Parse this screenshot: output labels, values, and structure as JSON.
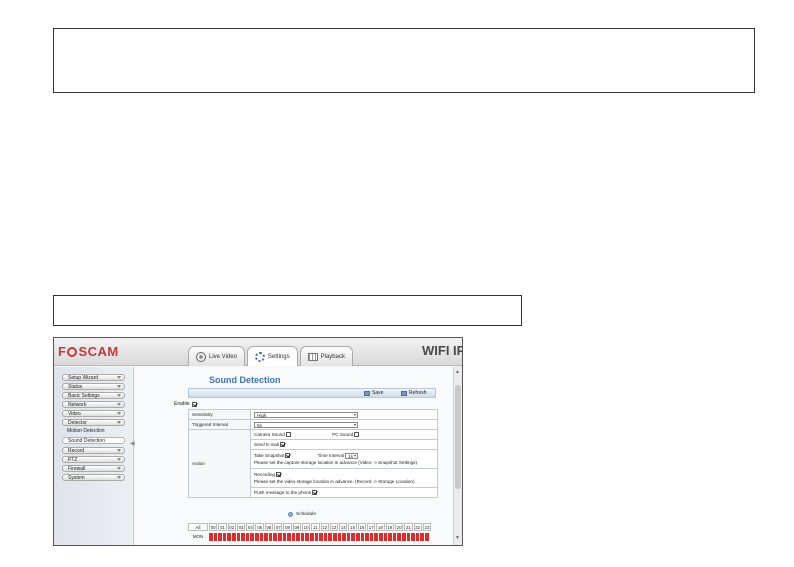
{
  "app": {
    "logo": "F   SCAM",
    "brand": "WIFI IP C"
  },
  "tabs": [
    {
      "label": "Live Video",
      "icon": "camera-icon"
    },
    {
      "label": "Settings",
      "icon": "gear-icon"
    },
    {
      "label": "Playback",
      "icon": "film-icon"
    }
  ],
  "sidebar": {
    "items": [
      {
        "label": "Setup Wizard"
      },
      {
        "label": "Status"
      },
      {
        "label": "Basic Settings"
      },
      {
        "label": "Network"
      },
      {
        "label": "Video"
      },
      {
        "label": "Detector"
      }
    ],
    "subitems": [
      {
        "label": "Motion Detection"
      },
      {
        "label": "Sound Detection"
      }
    ],
    "items_after": [
      {
        "label": "Record"
      },
      {
        "label": "PTZ"
      },
      {
        "label": "Firewall"
      },
      {
        "label": "System"
      }
    ]
  },
  "page": {
    "title": "Sound Detection",
    "save_label": "Save",
    "refresh_label": "Refresh",
    "enable_label": "Enable"
  },
  "form": {
    "sensitivity_label": "Sensitivity",
    "sensitivity_value": "High",
    "interval_label": "Triggered Interval",
    "interval_value": "5s",
    "action_label": "Action",
    "camera_sound": "Camera Sound",
    "pc_sound": "PC Sound",
    "send_email": "Send E-mail",
    "take_snapshot": "Take Snapshot",
    "time_interval_label": "Time Interval",
    "time_interval_value": "1s",
    "snapshot_note": "Please set the capture storage location in advance (Video -> Snapshot Settings)",
    "recording": "Recording",
    "recording_note": "Please set the video storage location in advance. (Record -> Storage Location)",
    "push_message": "Push message to the phone"
  },
  "schedule": {
    "label": "Schedule",
    "all_label": "All",
    "hours": [
      "00",
      "01",
      "02",
      "03",
      "04",
      "05",
      "06",
      "07",
      "08",
      "09",
      "10",
      "11",
      "12",
      "13",
      "14",
      "15",
      "16",
      "17",
      "18",
      "19",
      "20",
      "21",
      "22",
      "23"
    ],
    "day": "MON"
  }
}
